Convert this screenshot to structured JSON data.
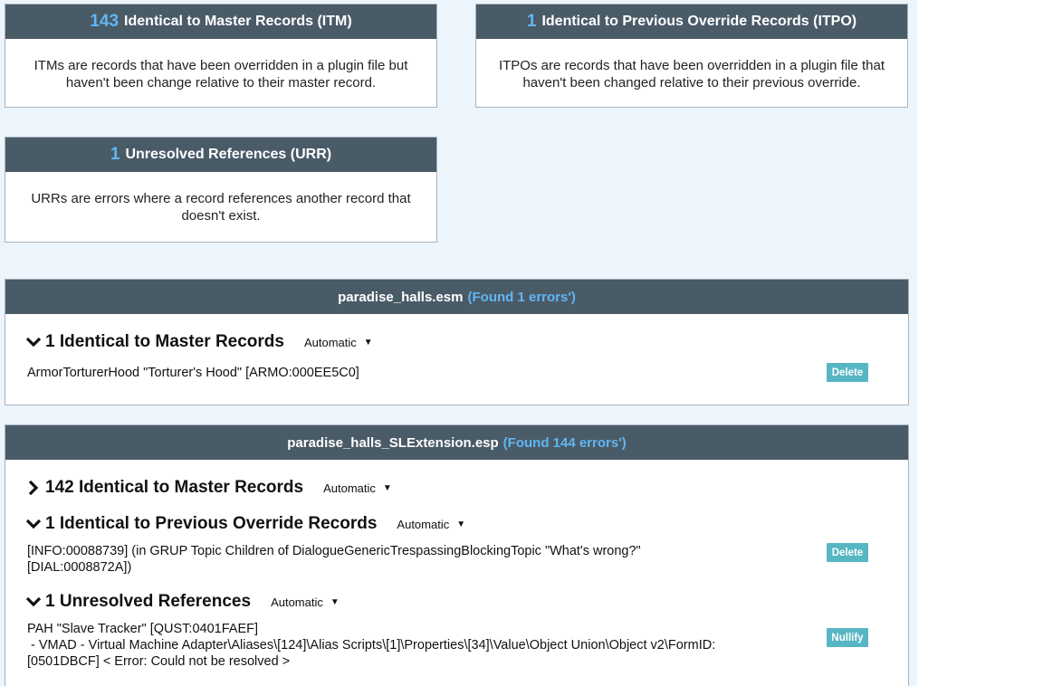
{
  "summary": [
    {
      "count": "143",
      "title": "Identical to Master Records (ITM)",
      "desc": "ITMs are records that have been overridden in a plugin file but haven't been change relative to their master record."
    },
    {
      "count": "1",
      "title": "Identical to Previous Override Records (ITPO)",
      "desc": "ITPOs are records that have been overridden in a plugin file that haven't been changed relative to their previous override."
    },
    {
      "count": "1",
      "title": "Unresolved References (URR)",
      "desc": "URRs are errors where a record references another record that doesn't exist."
    }
  ],
  "plugins": [
    {
      "name": "paradise_halls.esm",
      "found": "(Found 1 errors')",
      "groups": [
        {
          "title": "1 Identical to Master Records",
          "mode": "Automatic",
          "expanded": true,
          "items": [
            {
              "text": "ArmorTorturerHood \"Torturer's Hood\" [ARMO:000EE5C0]",
              "action": "Delete"
            }
          ]
        }
      ]
    },
    {
      "name": "paradise_halls_SLExtension.esp",
      "found": "(Found 144 errors')",
      "groups": [
        {
          "title": "142 Identical to Master Records",
          "mode": "Automatic",
          "expanded": false
        },
        {
          "title": "1 Identical to Previous Override Records",
          "mode": "Automatic",
          "expanded": true,
          "items": [
            {
              "line1": "[INFO:00088739] (in GRUP Topic Children of DialogueGenericTrespassingBlockingTopic \"What's wrong?\"",
              "line2": "[DIAL:0008872A])",
              "action": "Delete"
            }
          ]
        },
        {
          "title": "1 Unresolved References",
          "mode": "Automatic",
          "expanded": true,
          "items": [
            {
              "line1": "PAH \"Slave Tracker\" [QUST:0401FAEF]",
              "line2": " - VMAD - Virtual Machine Adapter\\Aliases\\[124]\\Alias Scripts\\[1]\\Properties\\[34]\\Value\\Object Union\\Object v2\\FormID:",
              "line3": "[0501DBCF] < Error: Could not be resolved >",
              "action": "Nullify"
            }
          ]
        }
      ]
    }
  ],
  "icons": {
    "expanded": "chevron-down-icon",
    "collapsed": "chevron-right-icon",
    "dropdown": "caret-down-icon"
  },
  "colors": {
    "header_bg": "#4a5b68",
    "count_accent": "#61b6f2",
    "button_bg": "#57b6c3",
    "page_bg": "#edf5fc"
  }
}
